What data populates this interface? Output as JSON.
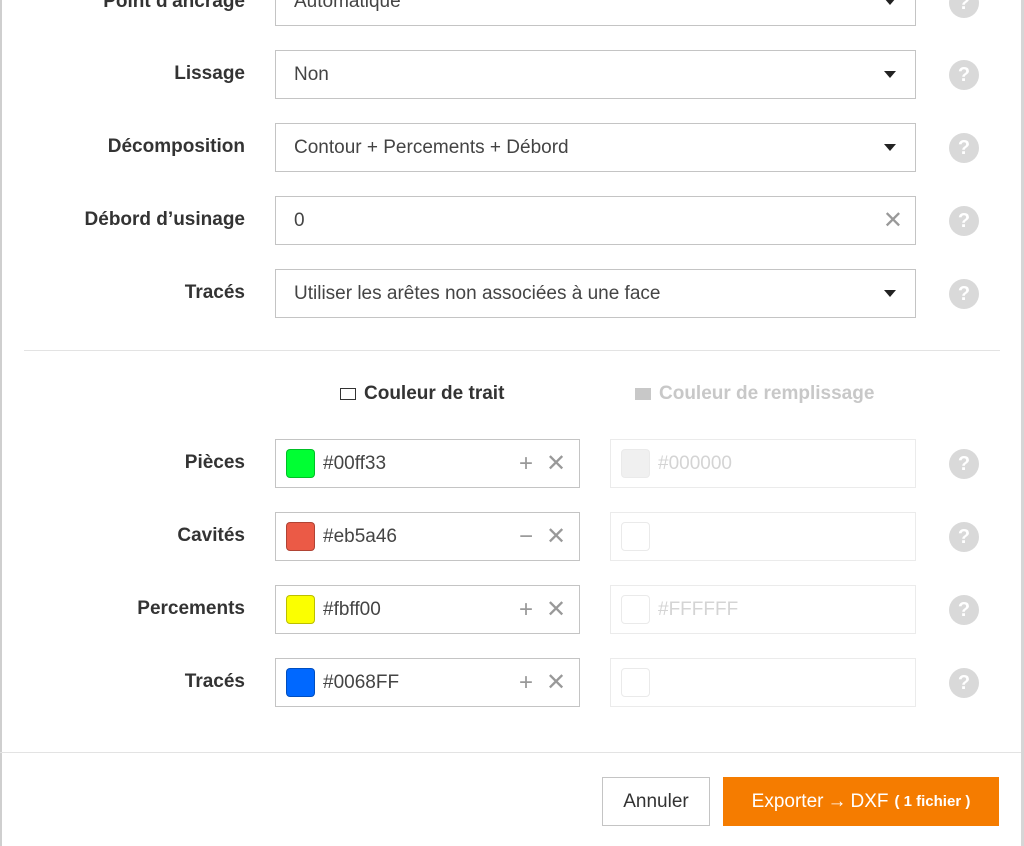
{
  "settings": {
    "anchor": {
      "label": "Point d'ancrage",
      "value": "Automatique"
    },
    "smoothing": {
      "label": "Lissage",
      "value": "Non"
    },
    "decomposition": {
      "label": "Décomposition",
      "value": "Contour + Percements + Débord"
    },
    "overcut": {
      "label": "Débord d’usinage",
      "value": "0"
    },
    "traces": {
      "label": "Tracés",
      "value": "Utiliser les arêtes non associées à une face"
    }
  },
  "icons": {
    "dropdown": "caret-down-icon",
    "clear": "close-icon",
    "help": "help-icon",
    "add": "plus-icon",
    "remove": "minus-icon"
  },
  "glyphs": {
    "help": "?",
    "clear": "✕",
    "plus": "+",
    "minus": "−",
    "arrow": "→"
  },
  "colors_section": {
    "stroke_header": "Couleur de trait",
    "fill_header": "Couleur de remplissage",
    "rows": [
      {
        "label": "Pièces",
        "stroke": "#00ff33",
        "stroke_swatch": "#00ff33",
        "fill": "#000000",
        "fill_swatch": "#f0f0f0"
      },
      {
        "label": "Cavités",
        "stroke": "#eb5a46",
        "stroke_swatch": "#eb5a46",
        "fill": "",
        "fill_swatch": "#ffffff"
      },
      {
        "label": "Percements",
        "stroke": "#fbff00",
        "stroke_swatch": "#fbff00",
        "fill": "#FFFFFF",
        "fill_swatch": "#ffffff"
      },
      {
        "label": "Tracés",
        "stroke": "#0068FF",
        "stroke_swatch": "#0068ff",
        "fill": "",
        "fill_swatch": "#ffffff"
      }
    ]
  },
  "footer": {
    "cancel": "Annuler",
    "export_prefix": "Exporter",
    "export_format": "DXF",
    "export_count": "( 1 fichier )"
  },
  "theme": {
    "accent": "#f57c00",
    "help_bg": "#d9d9d9"
  }
}
